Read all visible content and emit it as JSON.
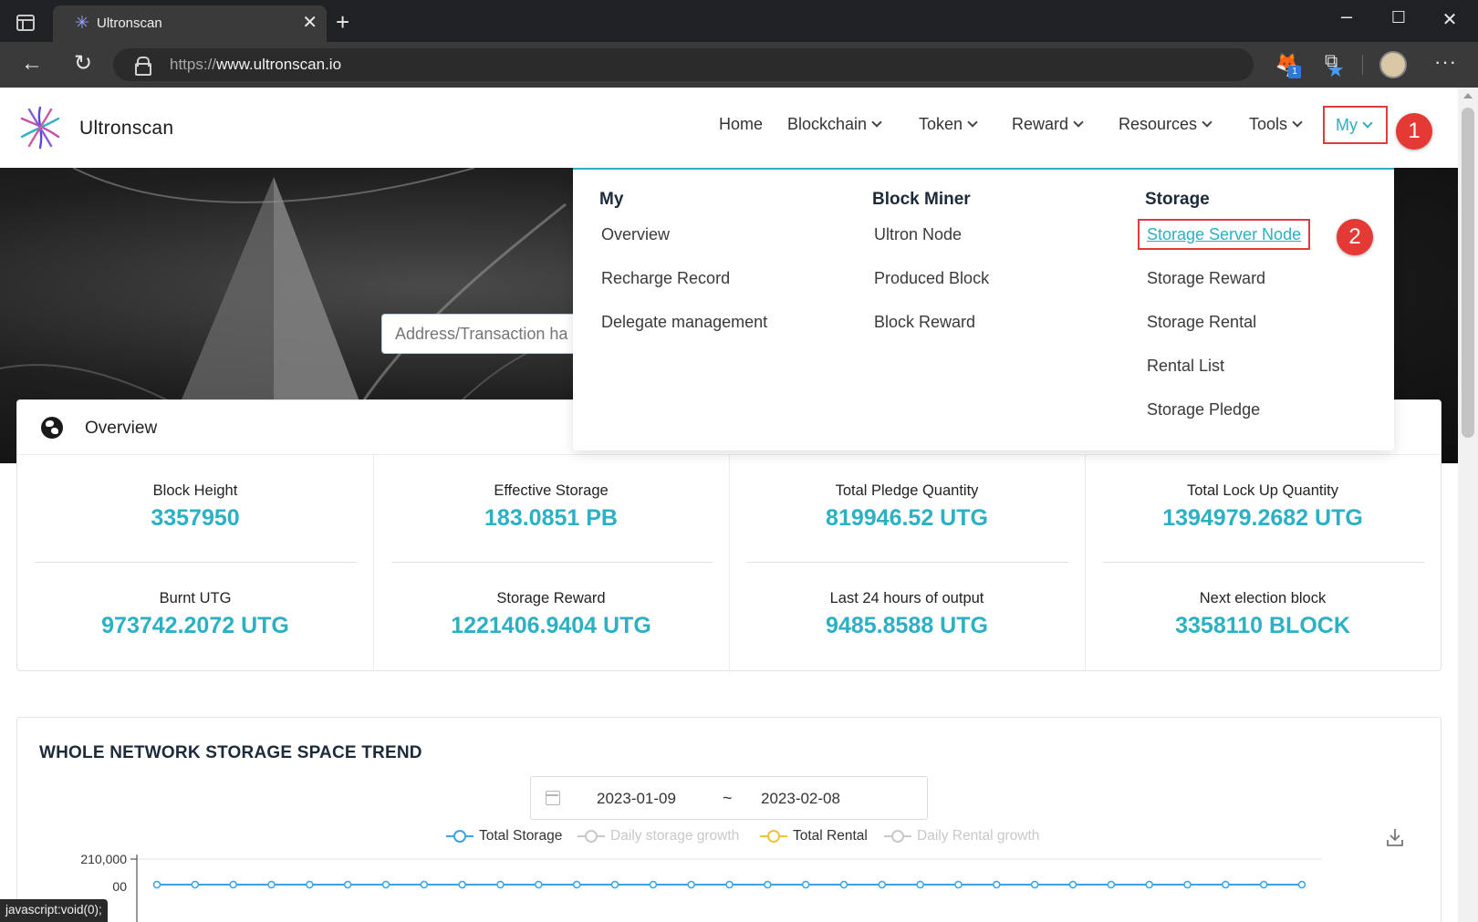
{
  "browser": {
    "tab_title": "Ultronscan",
    "url_scheme": "https://",
    "url_host": "www.ultronscan.io",
    "extension_badge": "1"
  },
  "header": {
    "logo_text": "Ultronscan",
    "nav": {
      "home": "Home",
      "blockchain": "Blockchain",
      "token": "Token",
      "reward": "Reward",
      "resources": "Resources",
      "tools": "Tools",
      "my": "My"
    }
  },
  "annotations": {
    "step1": "1",
    "step2": "2"
  },
  "search": {
    "placeholder": "Address/Transaction ha"
  },
  "dropdown": {
    "my": {
      "title": "My",
      "items": [
        "Overview",
        "Recharge Record",
        "Delegate management"
      ]
    },
    "block_miner": {
      "title": "Block Miner",
      "items": [
        "Ultron Node",
        "Produced Block",
        "Block Reward"
      ]
    },
    "storage": {
      "title": "Storage",
      "items": [
        "Storage Server Node",
        "Storage Reward",
        "Storage Rental",
        "Rental List",
        "Storage Pledge"
      ]
    }
  },
  "overview": {
    "title": "Overview",
    "stats": [
      {
        "label": "Block Height",
        "value": "3357950"
      },
      {
        "label": "Effective Storage",
        "value": "183.0851 PB"
      },
      {
        "label": "Total Pledge Quantity",
        "value": "819946.52 UTG"
      },
      {
        "label": "Total Lock Up Quantity",
        "value": "1394979.2682 UTG"
      },
      {
        "label": "Burnt UTG",
        "value": "973742.2072 UTG"
      },
      {
        "label": "Storage Reward",
        "value": "1221406.9404 UTG"
      },
      {
        "label": "Last 24 hours of output",
        "value": "9485.8588 UTG"
      },
      {
        "label": "Next election block",
        "value": "3358110 BLOCK"
      }
    ]
  },
  "trend": {
    "title": "WHOLE NETWORK STORAGE SPACE TREND",
    "date_start": "2023-01-09",
    "date_separator": "~",
    "date_end": "2023-02-08"
  },
  "chart_data": {
    "type": "line",
    "title": "WHOLE NETWORK STORAGE SPACE TREND",
    "legend": [
      {
        "name": "Total Storage",
        "color": "#3ea3e0",
        "active": true
      },
      {
        "name": "Daily storage growth",
        "color": "#c8c8c8",
        "active": false
      },
      {
        "name": "Total Rental",
        "color": "#f0c23a",
        "active": true
      },
      {
        "name": "Daily Rental growth",
        "color": "#c8c8c8",
        "active": false
      }
    ],
    "y_ticks_visible": [
      "210,000",
      "00"
    ],
    "x_range": [
      "2023-01-09",
      "2023-02-08"
    ],
    "series": [
      {
        "name": "Total Storage",
        "values": [
          187000,
          187000,
          187000,
          187000,
          187000,
          187000,
          187000,
          187000,
          187000,
          187000,
          187000,
          187000,
          187000,
          187000,
          187000,
          187000,
          187000,
          187000,
          187000,
          187000,
          187000,
          187000,
          187000,
          187000,
          187000,
          187000,
          187000,
          187000,
          187000,
          187000,
          187000
        ]
      }
    ],
    "legend_placement": "top-center",
    "grid": false
  },
  "status": {
    "text": "javascript:void(0);"
  },
  "colors": {
    "accent": "#2bb0c4",
    "highlight_border": "#e03a3a",
    "marker": "#e53935",
    "title_dark": "#1d2a3a"
  }
}
